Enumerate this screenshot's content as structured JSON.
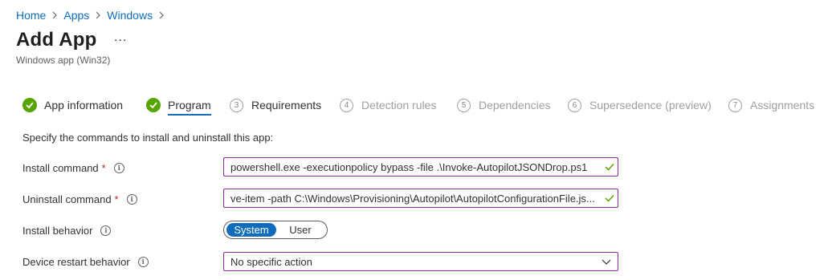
{
  "breadcrumb": [
    {
      "label": "Home"
    },
    {
      "label": "Apps"
    },
    {
      "label": "Windows"
    }
  ],
  "page": {
    "title": "Add App",
    "more": "...",
    "subtitle": "Windows app (Win32)"
  },
  "steps": [
    {
      "label": "App information",
      "state": "done",
      "number": ""
    },
    {
      "label": "Program",
      "state": "active",
      "number": ""
    },
    {
      "label": "Requirements",
      "state": "normal",
      "number": "3"
    },
    {
      "label": "Detection rules",
      "state": "disabled",
      "number": "4"
    },
    {
      "label": "Dependencies",
      "state": "disabled",
      "number": "5"
    },
    {
      "label": "Supersedence (preview)",
      "state": "disabled",
      "number": "6"
    },
    {
      "label": "Assignments",
      "state": "disabled",
      "number": "7"
    }
  ],
  "form": {
    "instructions": "Specify the commands to install and uninstall this app:",
    "install_command": {
      "label": "Install command",
      "required": "*",
      "value": "powershell.exe -executionpolicy bypass -file .\\Invoke-AutopilotJSONDrop.ps1"
    },
    "uninstall_command": {
      "label": "Uninstall command",
      "required": "*",
      "value": "ve-item -path C:\\Windows\\Provisioning\\Autopilot\\AutopilotConfigurationFile.js..."
    },
    "install_behavior": {
      "label": "Install behavior",
      "options": [
        "System",
        "User"
      ],
      "selected": "System"
    },
    "device_restart_behavior": {
      "label": "Device restart behavior",
      "value": "No specific action"
    }
  },
  "colors": {
    "accent": "#0f6cbd",
    "success": "#57a300",
    "field_border": "#8a2a9e",
    "required": "#a4262c"
  }
}
